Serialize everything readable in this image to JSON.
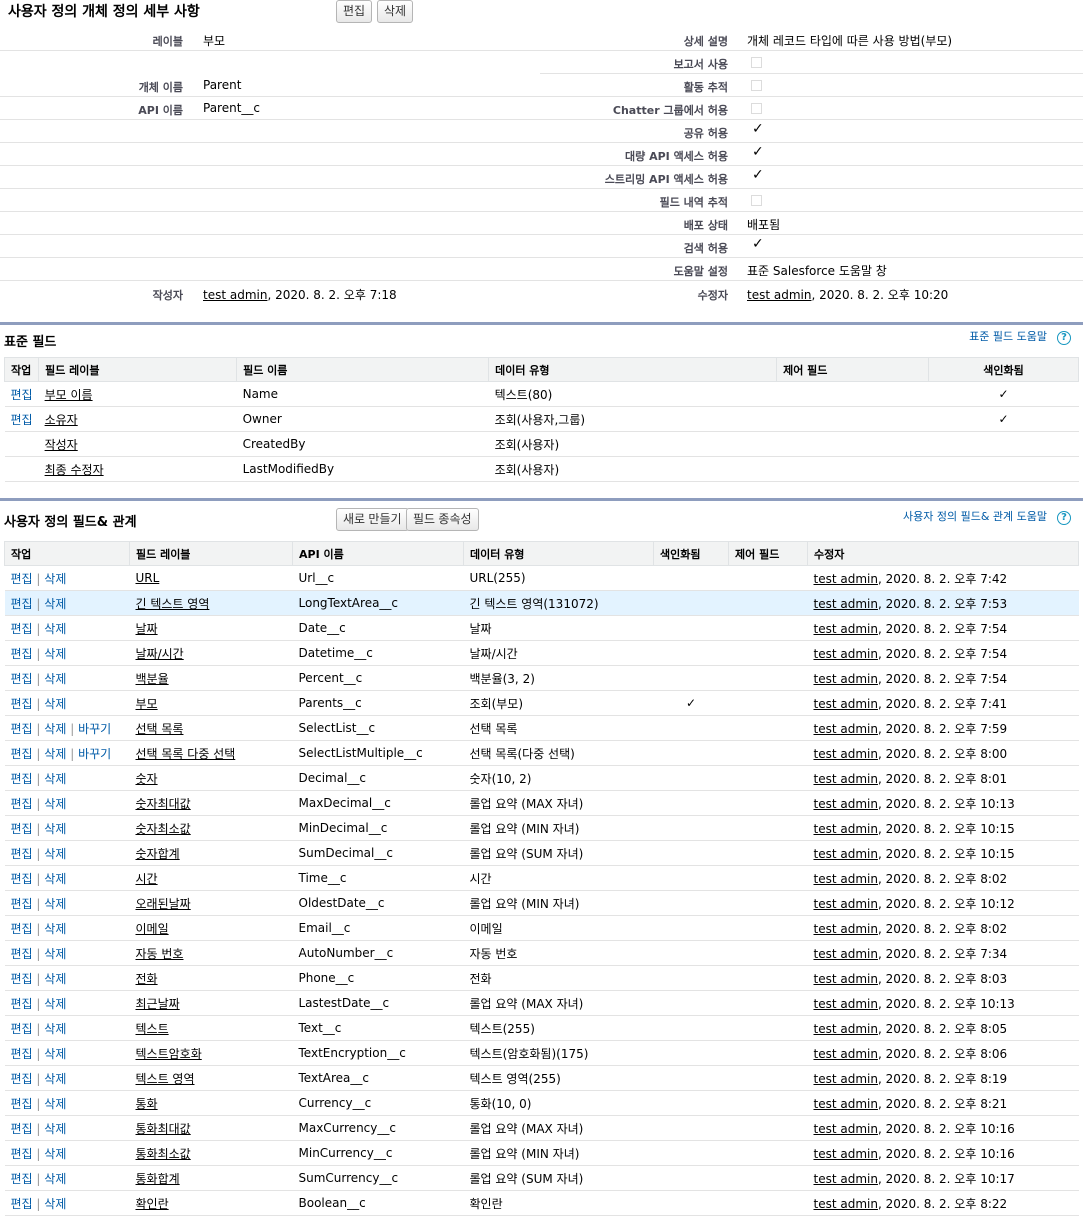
{
  "header": {
    "title": "사용자 정의 개체 정의 세부 사항",
    "edit_button": "편집",
    "delete_button": "삭제"
  },
  "details": {
    "label_label": "레이블",
    "label_value": "부모",
    "description_label": "상세 설명",
    "description_value": "개체 레코드 타입에 따른 사용 방법(부모)",
    "reports_label": "보고서 사용",
    "activities_label": "활동 추적",
    "object_name_label": "개체 이름",
    "object_name_value": "Parent",
    "api_name_label": "API 이름",
    "api_name_value": "Parent__c",
    "chatter_label": "Chatter 그룹에서 허용",
    "sharing_label": "공유 허용",
    "bulk_api_label": "대량 API 액세스 허용",
    "streaming_api_label": "스트리밍 API 액세스 허용",
    "field_history_label": "필드 내역 추적",
    "deploy_status_label": "배포 상태",
    "deploy_status_value": "배포됨",
    "search_label": "검색 허용",
    "help_setting_label": "도움말 설정",
    "help_setting_value": "표준 Salesforce 도움말 창",
    "created_by_label": "작성자",
    "created_by_user": "test admin",
    "created_by_date": ", 2020. 8. 2. 오후 7:18",
    "modified_by_label": "수정자",
    "modified_by_user": "test admin",
    "modified_by_date": ", 2020. 8. 2. 오후 10:20",
    "check_mark": "✓"
  },
  "standard_fields": {
    "title": "표준 필드",
    "help_link": "표준 필드 도움말",
    "columns": [
      "작업",
      "필드 레이블",
      "필드 이름",
      "데이터 유형",
      "제어 필드",
      "색인화됨"
    ],
    "rows": [
      {
        "action": "편집",
        "label": "부모 이름",
        "name": "Name",
        "type": "텍스트(80)",
        "control": "",
        "indexed": "✓"
      },
      {
        "action": "편집",
        "label": "소유자",
        "name": "Owner",
        "type": "조회(사용자,그룹)",
        "control": "",
        "indexed": "✓"
      },
      {
        "action": "",
        "label": "작성자",
        "name": "CreatedBy",
        "type": "조회(사용자)",
        "control": "",
        "indexed": ""
      },
      {
        "action": "",
        "label": "최종 수정자",
        "name": "LastModifiedBy",
        "type": "조회(사용자)",
        "control": "",
        "indexed": ""
      }
    ]
  },
  "custom_fields": {
    "title": "사용자 정의 필드& 관계",
    "new_button": "새로 만들기",
    "deps_button": "필드 종속성",
    "help_link": "사용자 정의 필드& 관계 도움말",
    "columns": [
      "작업",
      "필드 레이블",
      "API 이름",
      "데이터 유형",
      "색인화됨",
      "제어 필드",
      "수정자"
    ],
    "action_edit": "편집",
    "action_delete": "삭제",
    "action_replace": "바꾸기",
    "separator": "|",
    "rows": [
      {
        "label": "URL",
        "api": "Url__c",
        "type": "URL(255)",
        "indexed": "",
        "user": "test admin",
        "date": ", 2020. 8. 2. 오후 7:42",
        "replace": false
      },
      {
        "label": "긴 텍스트 영역",
        "api": "LongTextArea__c",
        "type": "긴 텍스트 영역(131072)",
        "indexed": "",
        "user": "test admin",
        "date": ", 2020. 8. 2. 오후 7:53",
        "replace": false
      },
      {
        "label": "날짜",
        "api": "Date__c",
        "type": "날짜",
        "indexed": "",
        "user": "test admin",
        "date": ", 2020. 8. 2. 오후 7:54",
        "replace": false
      },
      {
        "label": "날짜/시간",
        "api": "Datetime__c",
        "type": "날짜/시간",
        "indexed": "",
        "user": "test admin",
        "date": ", 2020. 8. 2. 오후 7:54",
        "replace": false
      },
      {
        "label": "백분율",
        "api": "Percent__c",
        "type": "백분율(3, 2)",
        "indexed": "",
        "user": "test admin",
        "date": ", 2020. 8. 2. 오후 7:54",
        "replace": false
      },
      {
        "label": "부모",
        "api": "Parents__c",
        "type": "조회(부모)",
        "indexed": "✓",
        "user": "test admin",
        "date": ", 2020. 8. 2. 오후 7:41",
        "replace": false
      },
      {
        "label": "선택 목록",
        "api": "SelectList__c",
        "type": "선택 목록",
        "indexed": "",
        "user": "test admin",
        "date": ", 2020. 8. 2. 오후 7:59",
        "replace": true
      },
      {
        "label": "선택 목록 다중 선택",
        "api": "SelectListMultiple__c",
        "type": "선택 목록(다중 선택)",
        "indexed": "",
        "user": "test admin",
        "date": ", 2020. 8. 2. 오후 8:00",
        "replace": true
      },
      {
        "label": "숫자",
        "api": "Decimal__c",
        "type": "숫자(10, 2)",
        "indexed": "",
        "user": "test admin",
        "date": ", 2020. 8. 2. 오후 8:01",
        "replace": false
      },
      {
        "label": "숫자최대값",
        "api": "MaxDecimal__c",
        "type": "롤업 요약 (MAX 자녀)",
        "indexed": "",
        "user": "test admin",
        "date": ", 2020. 8. 2. 오후 10:13",
        "replace": false
      },
      {
        "label": "숫자최소값",
        "api": "MinDecimal__c",
        "type": "롤업 요약 (MIN 자녀)",
        "indexed": "",
        "user": "test admin",
        "date": ", 2020. 8. 2. 오후 10:15",
        "replace": false
      },
      {
        "label": "숫자합계",
        "api": "SumDecimal__c",
        "type": "롤업 요약 (SUM 자녀)",
        "indexed": "",
        "user": "test admin",
        "date": ", 2020. 8. 2. 오후 10:15",
        "replace": false
      },
      {
        "label": "시간",
        "api": "Time__c",
        "type": "시간",
        "indexed": "",
        "user": "test admin",
        "date": ", 2020. 8. 2. 오후 8:02",
        "replace": false
      },
      {
        "label": "오래된날짜",
        "api": "OldestDate__c",
        "type": "롤업 요약 (MIN 자녀)",
        "indexed": "",
        "user": "test admin",
        "date": ", 2020. 8. 2. 오후 10:12",
        "replace": false
      },
      {
        "label": "이메일",
        "api": "Email__c",
        "type": "이메일",
        "indexed": "",
        "user": "test admin",
        "date": ", 2020. 8. 2. 오후 8:02",
        "replace": false
      },
      {
        "label": "자동 번호",
        "api": "AutoNumber__c",
        "type": "자동 번호",
        "indexed": "",
        "user": "test admin",
        "date": ", 2020. 8. 2. 오후 7:34",
        "replace": false
      },
      {
        "label": "전화",
        "api": "Phone__c",
        "type": "전화",
        "indexed": "",
        "user": "test admin",
        "date": ", 2020. 8. 2. 오후 8:03",
        "replace": false
      },
      {
        "label": "최근날짜",
        "api": "LastestDate__c",
        "type": "롤업 요약 (MAX 자녀)",
        "indexed": "",
        "user": "test admin",
        "date": ", 2020. 8. 2. 오후 10:13",
        "replace": false
      },
      {
        "label": "텍스트",
        "api": "Text__c",
        "type": "텍스트(255)",
        "indexed": "",
        "user": "test admin",
        "date": ", 2020. 8. 2. 오후 8:05",
        "replace": false
      },
      {
        "label": "텍스트암호화",
        "api": "TextEncryption__c",
        "type": "텍스트(암호화됨)(175)",
        "indexed": "",
        "user": "test admin",
        "date": ", 2020. 8. 2. 오후 8:06",
        "replace": false
      },
      {
        "label": "텍스트 영역",
        "api": "TextArea__c",
        "type": "텍스트 영역(255)",
        "indexed": "",
        "user": "test admin",
        "date": ", 2020. 8. 2. 오후 8:19",
        "replace": false
      },
      {
        "label": "통화",
        "api": "Currency__c",
        "type": "통화(10, 0)",
        "indexed": "",
        "user": "test admin",
        "date": ", 2020. 8. 2. 오후 8:21",
        "replace": false
      },
      {
        "label": "통화최대값",
        "api": "MaxCurrency__c",
        "type": "롤업 요약 (MAX 자녀)",
        "indexed": "",
        "user": "test admin",
        "date": ", 2020. 8. 2. 오후 10:16",
        "replace": false
      },
      {
        "label": "통화최소값",
        "api": "MinCurrency__c",
        "type": "롤업 요약 (MIN 자녀)",
        "indexed": "",
        "user": "test admin",
        "date": ", 2020. 8. 2. 오후 10:16",
        "replace": false
      },
      {
        "label": "통화합계",
        "api": "SumCurrency__c",
        "type": "롤업 요약 (SUM 자녀)",
        "indexed": "",
        "user": "test admin",
        "date": ", 2020. 8. 2. 오후 10:17",
        "replace": false
      },
      {
        "label": "확인란",
        "api": "Boolean__c",
        "type": "확인란",
        "indexed": "",
        "user": "test admin",
        "date": ", 2020. 8. 2. 오후 8:22",
        "replace": false
      }
    ]
  },
  "help_icon": "?"
}
